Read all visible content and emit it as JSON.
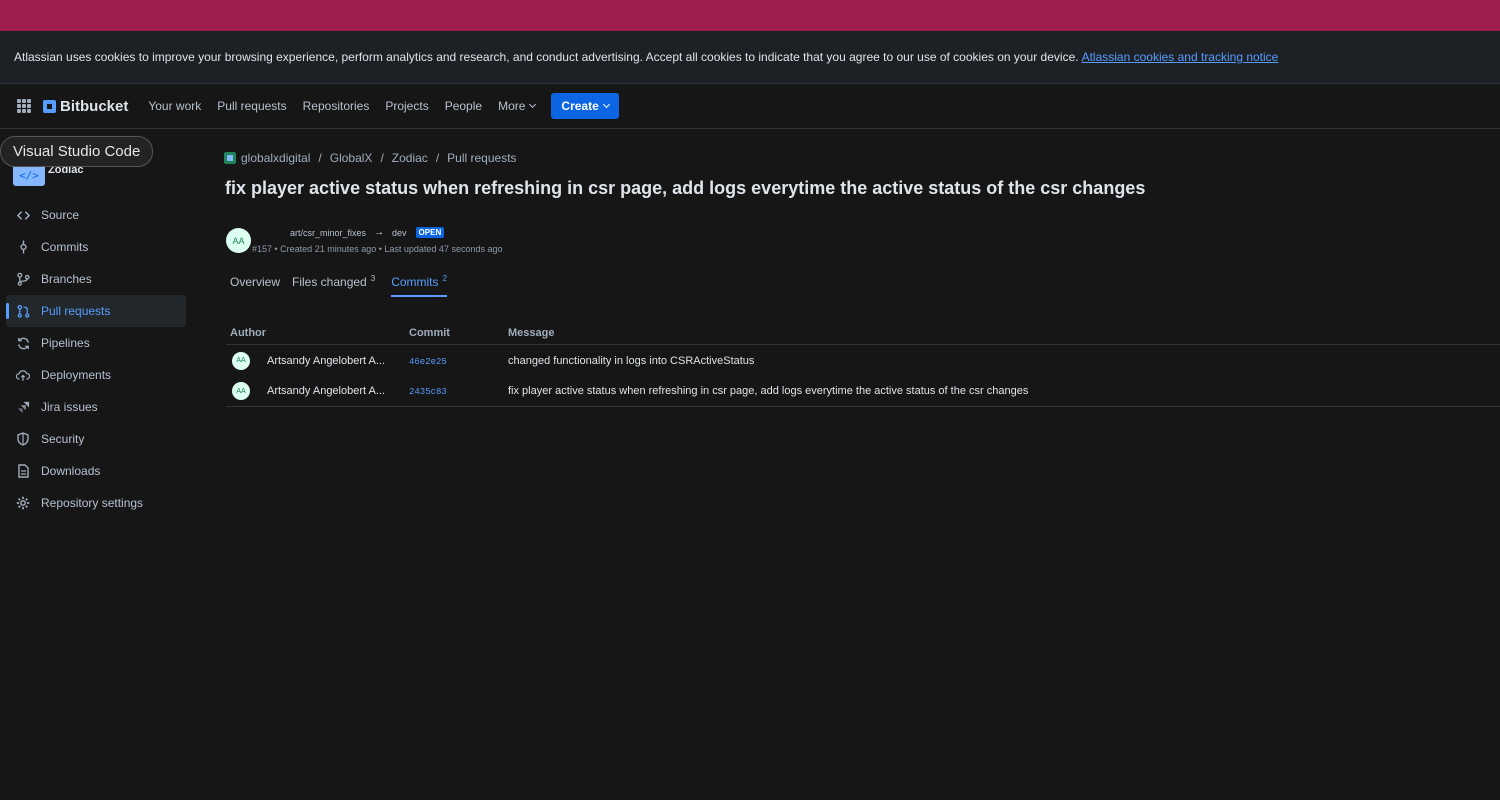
{
  "cookie": {
    "text": "Atlassian uses cookies to improve your browsing experience, perform analytics and research, and conduct advertising. Accept all cookies to indicate that you agree to our use of cookies on your device.",
    "link": "Atlassian cookies and tracking notice"
  },
  "nav": {
    "logo": "Bitbucket",
    "links": [
      "Your work",
      "Pull requests",
      "Repositories",
      "Projects",
      "People"
    ],
    "more": "More",
    "create": "Create"
  },
  "tooltip": "Visual Studio Code",
  "repo": {
    "name": "Zodiac",
    "icon_glyph": "</>"
  },
  "sidebar": {
    "items": [
      {
        "label": "Source",
        "icon": "code-icon"
      },
      {
        "label": "Commits",
        "icon": "commit-icon"
      },
      {
        "label": "Branches",
        "icon": "branch-icon"
      },
      {
        "label": "Pull requests",
        "icon": "pull-request-icon"
      },
      {
        "label": "Pipelines",
        "icon": "pipelines-icon"
      },
      {
        "label": "Deployments",
        "icon": "cloud-upload-icon"
      },
      {
        "label": "Jira issues",
        "icon": "jira-icon"
      },
      {
        "label": "Security",
        "icon": "shield-icon"
      },
      {
        "label": "Downloads",
        "icon": "document-icon"
      },
      {
        "label": "Repository settings",
        "icon": "gear-icon"
      }
    ]
  },
  "breadcrumb": [
    "globalxdigital",
    "GlobalX",
    "Zodiac",
    "Pull requests"
  ],
  "pr": {
    "title": "fix player active status when refreshing in csr page, add logs everytime the active status of the csr changes",
    "avatar": "AA",
    "source_branch": "art/csr_minor_fixes",
    "target_branch": "dev",
    "status": "OPEN",
    "meta": "#157 • Created 21 minutes ago • Last updated 47 seconds ago"
  },
  "tabs": [
    {
      "label": "Overview",
      "count": ""
    },
    {
      "label": "Files changed",
      "count": "3"
    },
    {
      "label": "Commits",
      "count": "2"
    }
  ],
  "table": {
    "headers": {
      "author": "Author",
      "commit": "Commit",
      "message": "Message"
    },
    "rows": [
      {
        "avatar": "AA",
        "author": "Artsandy Angelobert A...",
        "hash": "46e2e25",
        "message": "changed functionality in logs into CSRActiveStatus"
      },
      {
        "avatar": "AA",
        "author": "Artsandy Angelobert A...",
        "hash": "2435c83",
        "message": "fix player active status when refreshing in csr page, add logs everytime the active status of the csr changes"
      }
    ]
  },
  "colors": {
    "accent": "#579dff",
    "brand_strip": "#9e1f4e",
    "create_button": "#0c66e4"
  }
}
